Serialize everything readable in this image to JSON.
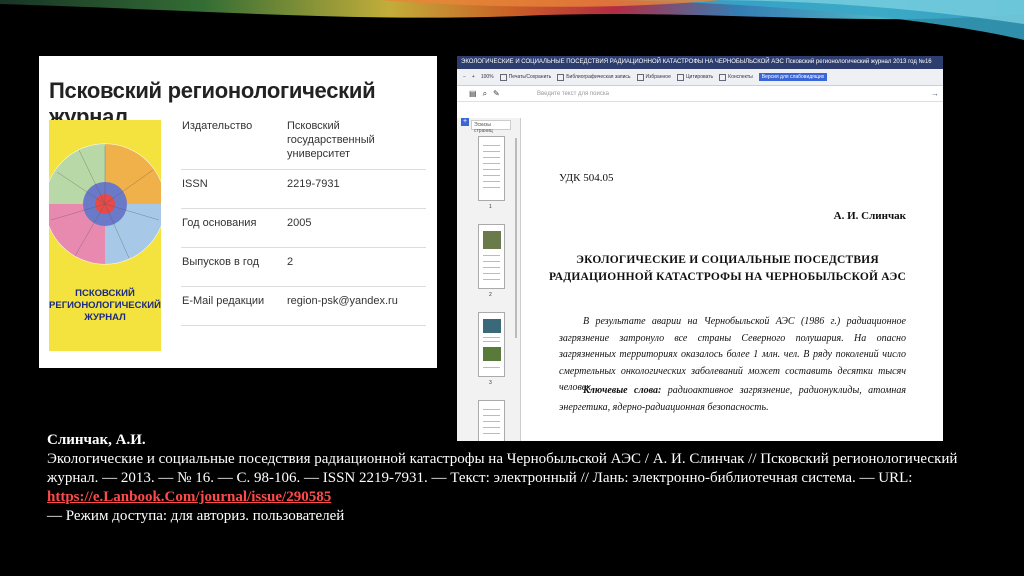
{
  "journal": {
    "title": "Псковский регионологический журнал",
    "cover_text": "ПСКОВСКИЙ РЕГИОНОЛОГИЧЕСКИЙ ЖУРНАЛ",
    "cover_color": "#f4e23e",
    "info": [
      {
        "key": "Издательство",
        "value": "Псковский государственный университет"
      },
      {
        "key": "ISSN",
        "value": "2219-7931"
      },
      {
        "key": "Год основания",
        "value": "2005"
      },
      {
        "key": "Выпусков в год",
        "value": "2"
      },
      {
        "key": "E-Mail редакции",
        "value": "region-psk@yandex.ru"
      }
    ]
  },
  "viewer": {
    "window_title": "ЭКОЛОГИЧЕСКИЕ И СОЦИАЛЬНЫЕ ПОСЕДСТВИЯ РАДИАЦИОННОЙ КАТАСТРОФЫ НА ЧЕРНОБЫЛЬСКОЙ АЭС Псковский регионологический журнал 2013 год №16",
    "zoom": "100%",
    "toolbar": {
      "print": "Печать/Сохранить",
      "bibliography": "Библиографическая запись",
      "favorites": "Избранное",
      "quote": "Цитировать",
      "notes": "Конспекты",
      "accessibility": "Версия для слабовидящих"
    },
    "search_placeholder": "Введите текст для поиска",
    "thumbs_tab": "Эскизы страниц",
    "page_numbers": [
      "1",
      "2",
      "3"
    ],
    "page": {
      "udk": "УДК 504.05",
      "author": "А. И. Слинчак",
      "title_line1": "ЭКОЛОГИЧЕСКИЕ И СОЦИАЛЬНЫЕ ПОСЕДСТВИЯ",
      "title_line2": "РАДИАЦИОННОЙ КАТАСТРОФЫ НА ЧЕРНОБЫЛЬСКОЙ АЭС",
      "abstract": "В результате аварии на Чернобыльской АЭС (1986 г.) радиационное загрязнение затронуло все страны Северного полушария. На опасно загрязненных территориях оказалось более 1 млн. чел. В ряду поколений число смертельных онкологических заболеваний может составить десятки тысяч человек.",
      "keywords_label": "Ключевые слова:",
      "keywords": " радиоактивное загрязнение, радионуклиды, атомная энергетика, ядерно-радиационная безопасность."
    }
  },
  "citation": {
    "author": "Слинчак, А.И.",
    "text": "Экологические и социальные поседствия радиационной катастрофы на Чернобыльской АЭС / А. И. Слинчак // Псковский регионологический журнал. — 2013. — № 16. — С. 98-106. — ISSN 2219-7931. — Текст: электронный // Лань: электронно-библиотечная система. — URL: ",
    "url": "https://e.Lanbook.Com/journal/issue/290585",
    "suffix": "— Режим доступа: для авториз. пользователей"
  },
  "colors": {
    "background": "#000000",
    "link": "#ff4a4a",
    "viewer_titlebar": "#2d3d6e",
    "accent_blue": "#3a66d8"
  }
}
